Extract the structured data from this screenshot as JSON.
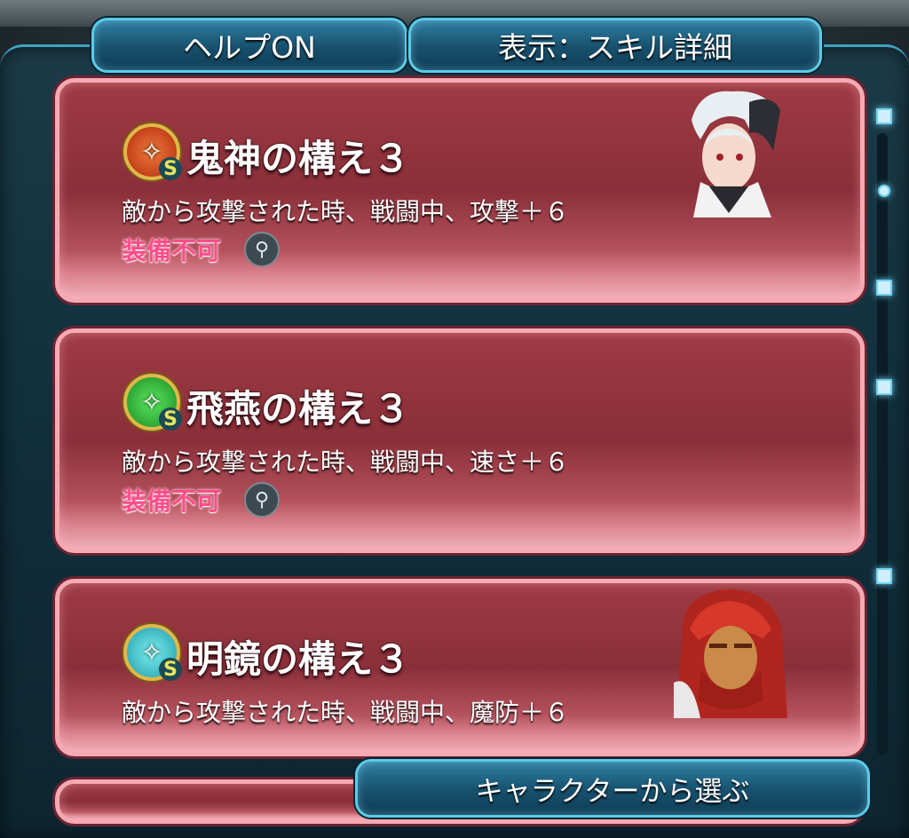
{
  "top_buttons": {
    "help": "ヘルプON",
    "display": "表示：スキル詳細"
  },
  "skills": [
    {
      "title": "鬼神の構え３",
      "description": "敵から攻撃された時、戦闘中、攻撃＋６",
      "equip_status": "装備不可",
      "icon_color": "#e0561e",
      "badge": "S",
      "has_portrait": true
    },
    {
      "title": "飛燕の構え３",
      "description": "敵から攻撃された時、戦闘中、速さ＋６",
      "equip_status": "装備不可",
      "icon_color": "#2fb33a",
      "badge": "S",
      "has_portrait": false
    },
    {
      "title": "明鏡の構え３",
      "description": "敵から攻撃された時、戦闘中、魔防＋６",
      "icon_color": "#2fc4d0",
      "badge": "S",
      "has_portrait": true
    }
  ],
  "bottom_button": "キャラクターから選ぶ",
  "icons": {
    "skill_icon_glyph": "✧",
    "weapon_icon_glyph": "⚲"
  }
}
